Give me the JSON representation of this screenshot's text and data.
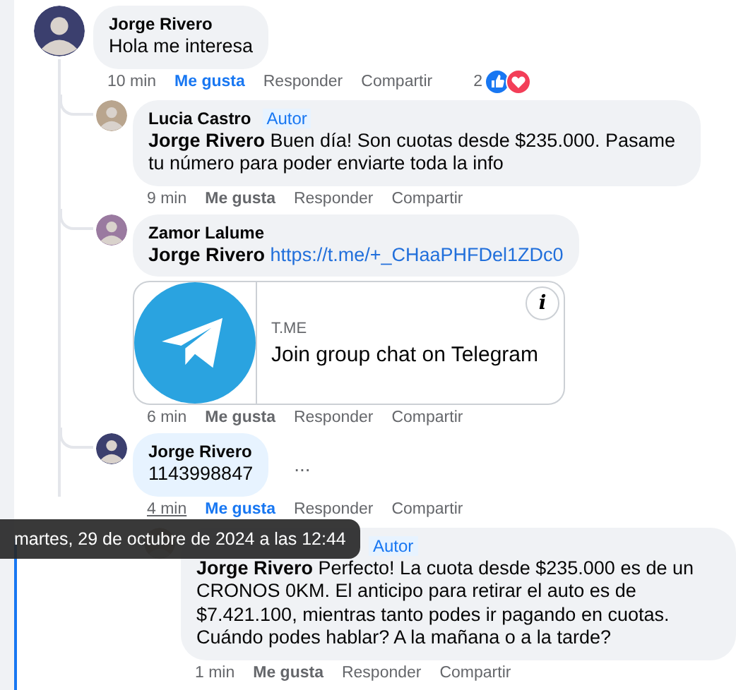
{
  "comment": {
    "author": "Jorge Rivero",
    "text": "Hola me interesa",
    "time": "10 min",
    "like": {
      "label": "Me gusta",
      "selected": true
    },
    "reply_label": "Responder",
    "share_label": "Compartir",
    "reactions": {
      "count": "2"
    },
    "replies": [
      {
        "kind": "text",
        "author": "Lucia Castro",
        "badge": "Autor",
        "text": "**Jorge Rivero** Buen día! Son cuotas desde $235.000. Pasame tu número para poder enviarte toda la info",
        "time": "9 min",
        "like": {
          "label": "Me gusta",
          "selected": false
        },
        "reply_label": "Responder",
        "share_label": "Compartir"
      },
      {
        "kind": "link",
        "author": "Zamor Lalume",
        "mention": "Jorge Rivero",
        "link": "https://t.me/+_CHaaPHFDel1ZDc0",
        "preview": {
          "domain": "T.ME",
          "title": "Join group chat on Telegram",
          "info_glyph": "i"
        },
        "time": "6 min",
        "like": {
          "label": "Me gusta",
          "selected": false
        },
        "reply_label": "Responder",
        "share_label": "Compartir"
      },
      {
        "kind": "text",
        "author": "Jorge Rivero",
        "text": "1143998847",
        "highlighted": true,
        "more": "...",
        "time": "4 min",
        "time_hovered": true,
        "like": {
          "label": "Me gusta",
          "selected": true
        },
        "reply_label": "Responder",
        "share_label": "Compartir",
        "replies": [
          {
            "kind": "text",
            "badge": "Autor",
            "text": "**Jorge Rivero** Perfecto! La cuota desde $235.000 es de un CRONOS 0KM. El anticipo para retirar el auto es de $7.421.100, mientras tanto podes ir pagando en cuotas. Cuándo podes hablar? A la mañana o a la tarde?",
            "time": "1 min",
            "like": {
              "label": "Me gusta",
              "selected": false
            },
            "reply_label": "Responder",
            "share_label": "Compartir"
          }
        ]
      }
    ]
  },
  "tooltip": "martes, 29 de octubre de 2024 a las 12:44"
}
